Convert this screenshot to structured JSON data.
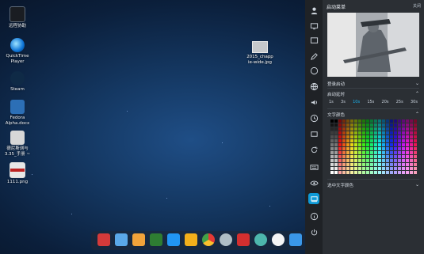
{
  "desktop": {
    "icons": [
      {
        "name": "rdpm-icon",
        "label": "远程协助",
        "color": "#1a1d22"
      },
      {
        "name": "quicktime-icon",
        "label": "QuickTime\nPlayer",
        "color": "#0c73d6"
      },
      {
        "name": "steam-icon",
        "label": "Steam",
        "color": "#0f2a46"
      },
      {
        "name": "fedora-doc-icon",
        "label": "Fedora\nAlpha.docx",
        "color": "#2c6fb6"
      },
      {
        "name": "chinese-doc-icon",
        "label": "德尼斯测与\n3.35_手册 ~",
        "color": "#d7d7d7"
      },
      {
        "name": "image-file-icon",
        "label": "1111.png",
        "color": "#b22"
      }
    ],
    "wallpaper_file": {
      "label": "2015_chapp\nie-wide.jpg"
    }
  },
  "dock": {
    "items": [
      {
        "name": "brush-icon",
        "color": "#d43a3a"
      },
      {
        "name": "folder-icon",
        "color": "#5aa8e8"
      },
      {
        "name": "store-icon",
        "color": "#f2a33a"
      },
      {
        "name": "music-icon",
        "color": "#2e7d32"
      },
      {
        "name": "media-player-icon",
        "color": "#2196f3"
      },
      {
        "name": "browser-icon",
        "color": "#f3b01b"
      },
      {
        "name": "chrome-icon",
        "color": "#e53935"
      },
      {
        "name": "settings-icon",
        "color": "#b0bec5"
      },
      {
        "name": "terminal-icon",
        "color": "#d32f2f"
      },
      {
        "name": "globe-icon",
        "color": "#4db6ac"
      },
      {
        "name": "clock-icon",
        "color": "#f5f5f5"
      },
      {
        "name": "apps-icon",
        "color": "#3a97e8"
      },
      {
        "name": "calendar-icon",
        "color": "#f2f2f2"
      }
    ]
  },
  "panel": {
    "title": "启动菜单",
    "close_label": "关闭",
    "rows": {
      "startup_row": "登录启动",
      "timer_row": "启动延时",
      "text_color_row": "文字颜色",
      "selected_text_color_row": "选中文字颜色"
    },
    "timer_options": [
      "1s",
      "3s",
      "10s",
      "15s",
      "20s",
      "25s",
      "30s"
    ],
    "timer_selected_index": 2,
    "sidebar": [
      {
        "name": "user-icon"
      },
      {
        "name": "display-icon"
      },
      {
        "name": "monitor-icon"
      },
      {
        "name": "edit-icon"
      },
      {
        "name": "palette-icon"
      },
      {
        "name": "globe-icon"
      },
      {
        "name": "volume-icon"
      },
      {
        "name": "clock-icon"
      },
      {
        "name": "power-icon"
      },
      {
        "name": "refresh-icon"
      },
      {
        "name": "tag-icon"
      },
      {
        "name": "keyboard-icon"
      },
      {
        "name": "eye-icon"
      },
      {
        "name": "dock-icon"
      },
      {
        "name": "info-icon"
      },
      {
        "name": "logout-icon"
      }
    ]
  }
}
